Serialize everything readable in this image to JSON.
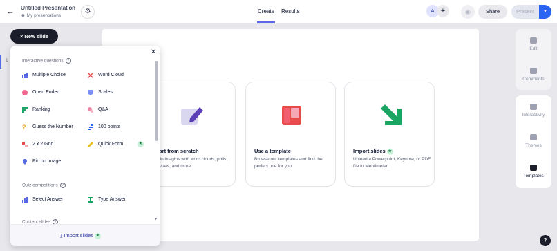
{
  "header": {
    "back_icon": "arrow-left-icon",
    "title": "Untitled Presentation",
    "subtitle": "My presentations",
    "tabs": [
      {
        "label": "Create",
        "active": true
      },
      {
        "label": "Results",
        "active": false
      }
    ],
    "avatar_initial": "A",
    "share_label": "Share",
    "present_label": "Present"
  },
  "left_rail": {
    "new_slide_label": "New slide",
    "slide_number": "1"
  },
  "menu": {
    "sections": [
      {
        "heading": "Interactive questions",
        "items": [
          {
            "label": "Multiple Choice",
            "icon": "bar-chart-icon",
            "color": "#5769e7"
          },
          {
            "label": "Word Cloud",
            "icon": "word-cloud-icon",
            "color": "#e84b4b"
          },
          {
            "label": "Open Ended",
            "icon": "speech-bubble-icon",
            "color": "#f26690"
          },
          {
            "label": "Scales",
            "icon": "scales-icon",
            "color": "#7b8ff7"
          },
          {
            "label": "Ranking",
            "icon": "ranking-icon",
            "color": "#1aa662"
          },
          {
            "label": "Q&A",
            "icon": "qa-icon",
            "color": "#f08aa8"
          },
          {
            "label": "Guess the Number",
            "icon": "question-mark-icon",
            "color": "#e8a21c"
          },
          {
            "label": "100 points",
            "icon": "points-icon",
            "color": "#2b63f2"
          },
          {
            "label": "2 x 2 Grid",
            "icon": "grid-icon",
            "color": "#e84b4b"
          },
          {
            "label": "Quick Form",
            "icon": "pencil-icon",
            "color": "#e8c21c"
          },
          {
            "label": "Pin on Image",
            "icon": "pin-icon",
            "color": "#5769e7"
          }
        ]
      },
      {
        "heading": "Quiz competitions",
        "items": [
          {
            "label": "Select Answer",
            "icon": "bar-chart-icon",
            "color": "#5769e7"
          },
          {
            "label": "Type Answer",
            "icon": "text-cursor-icon",
            "color": "#1aa662"
          }
        ]
      },
      {
        "heading": "Content slides",
        "items": []
      }
    ],
    "footer_label": "Import slides"
  },
  "cards": [
    {
      "title": "Start from scratch",
      "description": "Gain insights with word clouds, polls, quizzes, and more.",
      "icon": "edit-square-icon"
    },
    {
      "title": "Use a template",
      "description": "Browse our templates and find the perfect one for you.",
      "icon": "template-icon"
    },
    {
      "title": "Import slides",
      "description": "Upload a Powerpoint, Keynote, or PDF file to Mentimeter.",
      "icon": "import-arrow-icon"
    }
  ],
  "right_panel": {
    "items": [
      {
        "label": "Edit",
        "icon": "edit-icon"
      },
      {
        "label": "Comments",
        "icon": "comment-icon"
      },
      {
        "label": "Interactivity",
        "icon": "interactivity-icon"
      },
      {
        "label": "Themes",
        "icon": "themes-icon"
      },
      {
        "label": "Templates",
        "icon": "templates-icon",
        "active": true
      }
    ]
  },
  "help_label": "?"
}
